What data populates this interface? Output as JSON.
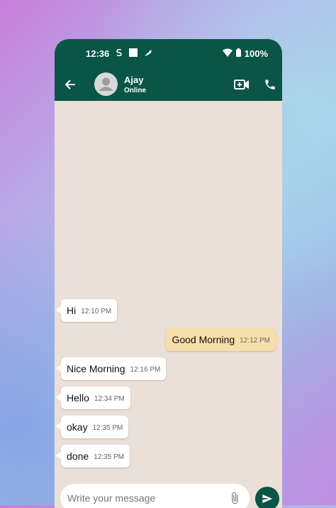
{
  "status_bar": {
    "time": "12:36",
    "battery": "100%"
  },
  "header": {
    "name": "Ajay",
    "status": "Online"
  },
  "messages": [
    {
      "side": "in",
      "text": "Hi",
      "time": "12:10 PM"
    },
    {
      "side": "out",
      "text": "Good Morning",
      "time": "12:12 PM"
    },
    {
      "side": "in",
      "text": "Nice Morning",
      "time": "12:16 PM"
    },
    {
      "side": "in",
      "text": "Hello",
      "time": "12:34 PM"
    },
    {
      "side": "in",
      "text": "okay",
      "time": "12:35 PM"
    },
    {
      "side": "in",
      "text": "done",
      "time": "12:35 PM"
    }
  ],
  "composer": {
    "placeholder": "Write your message"
  },
  "icons": {
    "back": "arrow-back-icon",
    "avatar": "person-icon",
    "video": "video-call-icon",
    "call": "phone-icon",
    "attach": "paperclip-icon",
    "send": "send-icon",
    "wifi": "wifi-icon",
    "battery": "battery-icon"
  },
  "colors": {
    "header": "#0a5548",
    "chat_bg": "#ebe0d8",
    "incoming": "#ffffff",
    "outgoing": "#f7dfaa",
    "send_button": "#0a5548"
  }
}
